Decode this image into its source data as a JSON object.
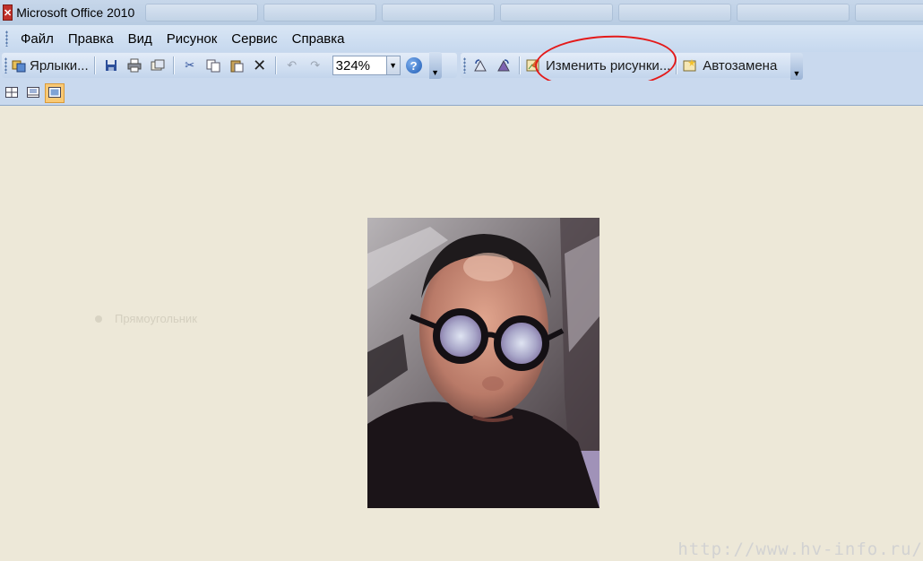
{
  "window": {
    "title": "Microsoft Office 2010",
    "icon": "office-picture-manager-icon"
  },
  "menu": {
    "items": [
      {
        "key": "file",
        "label": "Файл"
      },
      {
        "key": "edit",
        "label": "Правка"
      },
      {
        "key": "view",
        "label": "Вид"
      },
      {
        "key": "picture",
        "label": "Рисунок"
      },
      {
        "key": "tools",
        "label": "Сервис"
      },
      {
        "key": "help",
        "label": "Справка"
      }
    ]
  },
  "toolbar": {
    "shortcuts_label": "Ярлыки...",
    "zoom_value": "324%",
    "edit_pictures_label": "Изменить рисунки...",
    "autocorrect_label": "Автозамена",
    "icons": [
      "shortcuts-icon",
      "save-icon",
      "print-icon",
      "email-icon",
      "cut-icon",
      "copy-icon",
      "paste-icon",
      "delete-icon",
      "undo-icon",
      "redo-icon",
      "zoom-dropdown-icon",
      "help-icon",
      "rotate-left-icon",
      "rotate-right-icon",
      "edit-pictures-icon",
      "autocorrect-icon"
    ]
  },
  "view_bar": {
    "icons": [
      "thumbnail-view-icon",
      "filmstrip-view-icon",
      "single-picture-view-icon"
    ],
    "active": "single-picture-view-icon"
  },
  "canvas": {
    "ghost_label": "Прямоугольник",
    "photo": "portrait-photo-man-glasses"
  },
  "annotation": {
    "color": "#e41a1a"
  },
  "watermark": "http://www.hv-info.ru/",
  "colors": {
    "canvas_bg": "#ede8d8",
    "toolbar_bg": "#c9d9ee",
    "active_button": "#f9c975"
  }
}
